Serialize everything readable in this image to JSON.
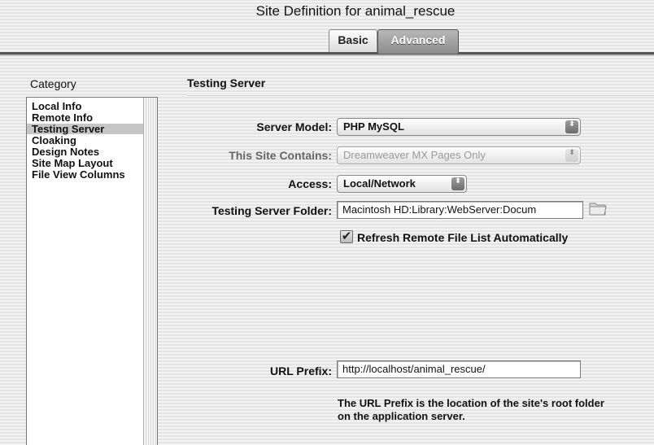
{
  "window": {
    "title": "Site Definition for animal_rescue"
  },
  "tabs": [
    {
      "label": "Basic",
      "selected": false
    },
    {
      "label": "Advanced",
      "selected": true
    }
  ],
  "category": {
    "heading": "Category",
    "items": [
      {
        "label": "Local Info",
        "selected": false
      },
      {
        "label": "Remote Info",
        "selected": false
      },
      {
        "label": "Testing Server",
        "selected": true
      },
      {
        "label": "Cloaking",
        "selected": false
      },
      {
        "label": "Design Notes",
        "selected": false
      },
      {
        "label": "Site Map Layout",
        "selected": false
      },
      {
        "label": "File View Columns",
        "selected": false
      }
    ]
  },
  "panel": {
    "title": "Testing Server",
    "server_model": {
      "label": "Server Model:",
      "value": "PHP MySQL"
    },
    "site_contains": {
      "label": "This Site Contains:",
      "value": "Dreamweaver MX Pages Only",
      "disabled": true
    },
    "access": {
      "label": "Access:",
      "value": "Local/Network"
    },
    "server_folder": {
      "label": "Testing Server Folder:",
      "value": "Macintosh HD:Library:WebServer:Docum"
    },
    "refresh": {
      "label": "Refresh Remote File List Automatically",
      "checked": true,
      "check_glyph": "✔"
    },
    "url_prefix": {
      "label": "URL Prefix:",
      "value": "http://localhost/animal_rescue/"
    },
    "help_text": "The URL Prefix is the location of the site's root folder on the application server."
  },
  "icons": {
    "popup_arrows": "⬍",
    "folder": "folder-icon"
  }
}
